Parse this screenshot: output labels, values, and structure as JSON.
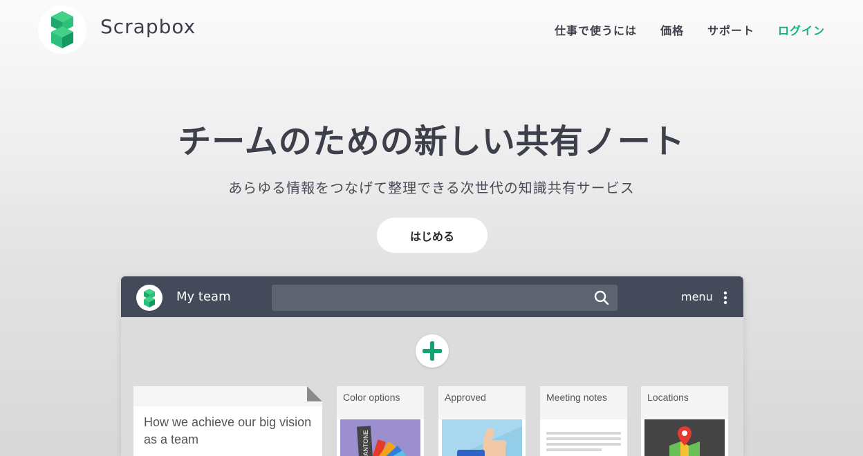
{
  "header": {
    "brand": "Scrapbox",
    "nav": [
      {
        "label": "仕事で使うには"
      },
      {
        "label": "価格"
      },
      {
        "label": "サポート"
      },
      {
        "label": "ログイン"
      }
    ]
  },
  "hero": {
    "title": "チームのための新しい共有ノート",
    "subtitle": "あらゆる情報をつなげて整理できる次世代の知識共有サービス",
    "cta": "はじめる"
  },
  "app": {
    "team_name": "My team",
    "menu_label": "menu",
    "cards": [
      {
        "title": "How we achieve our big vision as a team"
      },
      {
        "title": "Color options",
        "thumb_text": "PANTONE"
      },
      {
        "title": "Approved"
      },
      {
        "title": "Meeting notes"
      },
      {
        "title": "Locations"
      }
    ]
  },
  "colors": {
    "accent": "#16b27b",
    "app_bar": "#444a59",
    "text": "#3d3f4a"
  },
  "icons": [
    "scrapbox-logo-icon",
    "search-icon",
    "more-vertical-icon",
    "plus-icon",
    "map-pin-icon",
    "thumbs-up-icon"
  ]
}
